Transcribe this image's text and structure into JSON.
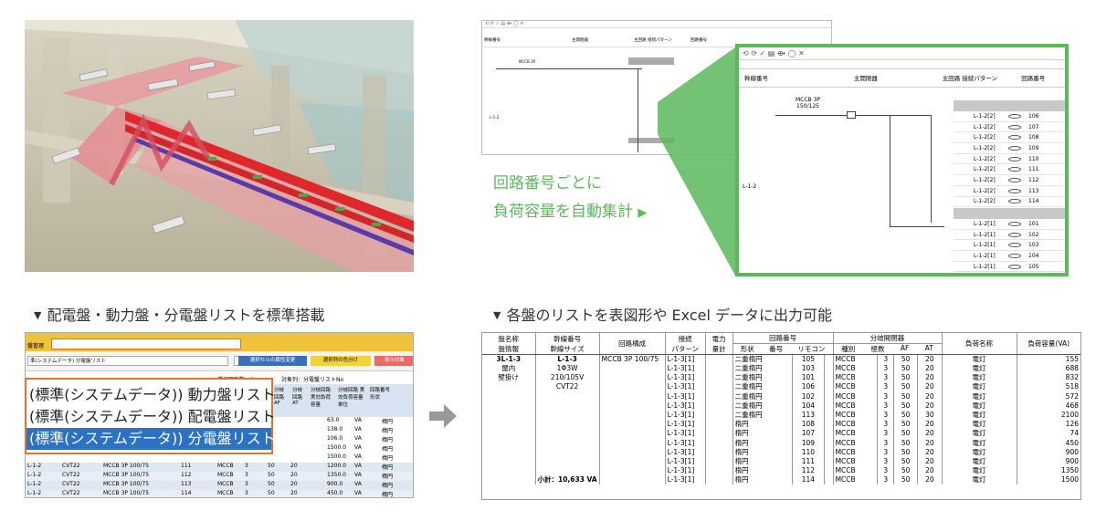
{
  "callout": {
    "line1": "回路番号ごとに",
    "line2": "負荷容量を自動集計",
    "arrow": "▶",
    "color": "#5cb85c"
  },
  "captions": {
    "left": "配電盤・動力盤・分電盤リストを標準搭載",
    "right": "各盤のリストを表図形や Excel データに出力可能",
    "marker": "▼"
  },
  "schematic": {
    "toolbar_icons": "⟲ ⟳ ✓ ▤ ⟴ ◯ ✕",
    "headers": [
      "幹線番号",
      "主開閉器",
      "主回路 接続パターン",
      "回路番号"
    ],
    "main_label": "L-1-2",
    "breaker": "MCCB 3P",
    "breaker_rating": "150/125",
    "rows_a": [
      {
        "circuit": "L-1-2[2]",
        "num": "106"
      },
      {
        "circuit": "L-1-2[2]",
        "num": "107"
      },
      {
        "circuit": "L-1-2[2]",
        "num": "108"
      },
      {
        "circuit": "L-1-2[2]",
        "num": "109"
      },
      {
        "circuit": "L-1-2[2]",
        "num": "110"
      },
      {
        "circuit": "L-1-2[2]",
        "num": "111"
      },
      {
        "circuit": "L-1-2[2]",
        "num": "112"
      },
      {
        "circuit": "L-1-2[2]",
        "num": "113"
      },
      {
        "circuit": "L-1-2[2]",
        "num": "114"
      }
    ],
    "rows_b": [
      {
        "circuit": "L-1-2[1]",
        "num": "101"
      },
      {
        "circuit": "L-1-2[1]",
        "num": "102"
      },
      {
        "circuit": "L-1-2[1]",
        "num": "103"
      },
      {
        "circuit": "L-1-2[1]",
        "num": "104"
      },
      {
        "circuit": "L-1-2[1]",
        "num": "105"
      }
    ]
  },
  "listwin": {
    "menu": "盤管理",
    "dropdown": "準(システムデータ) 分電盤リスト",
    "btn_attr": "選択セルの属性変更",
    "btn_color": "選択列の色分け",
    "btn_extra": "表示対象",
    "selected_rows": "選択図形数：1",
    "target_col": "対象列：分電盤リストNo",
    "col_headers": [
      "分岐回路 AF",
      "分岐回路 AT",
      "分岐回路 実効負荷容量",
      "分岐回路 実効負荷容量単位",
      "回路番号 形状"
    ],
    "rows": [
      {
        "a": "L-1-2",
        "b": "CVT22",
        "c": "MCCB 3P 100/75",
        "d": "111",
        "e": "MCCB",
        "f": "3",
        "g": "50",
        "h": "20",
        "i": "1200.0",
        "j": "VA",
        "k": "楕円"
      },
      {
        "a": "L-1-2",
        "b": "CVT22",
        "c": "MCCB 3P 100/75",
        "d": "112",
        "e": "MCCB",
        "f": "3",
        "g": "50",
        "h": "20",
        "i": "1350.0",
        "j": "VA",
        "k": "楕円"
      },
      {
        "a": "L-1-2",
        "b": "CVT22",
        "c": "MCCB 3P 100/75",
        "d": "113",
        "e": "MCCB",
        "f": "3",
        "g": "50",
        "h": "20",
        "i": "900.0",
        "j": "VA",
        "k": "楕円"
      },
      {
        "a": "L-1-2",
        "b": "CVT22",
        "c": "MCCB 3P 100/75",
        "d": "114",
        "e": "MCCB",
        "f": "3",
        "g": "50",
        "h": "20",
        "i": "450.0",
        "j": "VA",
        "k": "楕円"
      }
    ],
    "upper_vals": [
      {
        "i": "63.0",
        "j": "VA",
        "k": "楕円"
      },
      {
        "i": "138.0",
        "j": "VA",
        "k": "楕円"
      },
      {
        "i": "106.0",
        "j": "VA",
        "k": "楕円"
      },
      {
        "i": "1500.0",
        "j": "VA",
        "k": "楕円"
      },
      {
        "i": "1500.0",
        "j": "VA",
        "k": "楕円"
      }
    ],
    "overlay": [
      "(標準(システムデータ)) 動力盤リスト",
      "(標準(システムデータ)) 配電盤リスト",
      "(標準(システムデータ)) 分電盤リスト"
    ]
  },
  "excel": {
    "headers": {
      "panel": "盤名称",
      "panel_base": "盤情報",
      "trunk": "幹線番号",
      "trunk_size": "幹線サイズ",
      "circuit_cfg": "回路構成",
      "conn": "接続",
      "conn2": "パターン",
      "power": "電力",
      "power2": "量計",
      "circuit_num": "回路番号",
      "shape": "形状",
      "num": "番号",
      "remote": "リモコン",
      "branch": "分岐開閉器",
      "type": "種別",
      "poles": "極数",
      "af": "AF",
      "at": "AT",
      "load_name": "負荷名称",
      "load_cap": "負荷容量(VA)"
    },
    "panel": {
      "name": "3L-1-3",
      "loc": "屋内",
      "mount": "壁掛け"
    },
    "trunk": {
      "num": "L-1-3",
      "phase": "1Φ3W",
      "volt": "210/105V",
      "cable": "CVT22"
    },
    "circuit_cfg": "MCCB 3P 100/75",
    "subtotal": "小計：10,633 VA",
    "rows": [
      {
        "conn": "L-1-3[1]",
        "shape": "二重楕円",
        "num": "105",
        "type": "MCCB",
        "poles": "3",
        "af": "50",
        "at": "20",
        "load": "電灯",
        "cap": "155"
      },
      {
        "conn": "L-1-3[1]",
        "shape": "二重楕円",
        "num": "103",
        "type": "MCCB",
        "poles": "3",
        "af": "50",
        "at": "20",
        "load": "電灯",
        "cap": "688"
      },
      {
        "conn": "L-1-3[1]",
        "shape": "二重楕円",
        "num": "101",
        "type": "MCCB",
        "poles": "3",
        "af": "50",
        "at": "20",
        "load": "電灯",
        "cap": "832"
      },
      {
        "conn": "L-1-3[1]",
        "shape": "二重楕円",
        "num": "106",
        "type": "MCCB",
        "poles": "3",
        "af": "50",
        "at": "20",
        "load": "電灯",
        "cap": "518"
      },
      {
        "conn": "L-1-3[1]",
        "shape": "二重楕円",
        "num": "102",
        "type": "MCCB",
        "poles": "3",
        "af": "50",
        "at": "20",
        "load": "電灯",
        "cap": "572"
      },
      {
        "conn": "L-1-3[1]",
        "shape": "二重楕円",
        "num": "104",
        "type": "MCCB",
        "poles": "3",
        "af": "50",
        "at": "20",
        "load": "電灯",
        "cap": "468"
      },
      {
        "conn": "L-1-3[1]",
        "shape": "二重楕円",
        "num": "113",
        "type": "MCCB",
        "poles": "3",
        "af": "50",
        "at": "30",
        "load": "電灯",
        "cap": "2100"
      },
      {
        "conn": "L-1-3[1]",
        "shape": "楕円",
        "num": "108",
        "type": "MCCB",
        "poles": "3",
        "af": "50",
        "at": "20",
        "load": "電灯",
        "cap": "126"
      },
      {
        "conn": "L-1-3[1]",
        "shape": "楕円",
        "num": "107",
        "type": "MCCB",
        "poles": "3",
        "af": "50",
        "at": "20",
        "load": "電灯",
        "cap": "74"
      },
      {
        "conn": "L-1-3[1]",
        "shape": "楕円",
        "num": "109",
        "type": "MCCB",
        "poles": "3",
        "af": "50",
        "at": "20",
        "load": "電灯",
        "cap": "450"
      },
      {
        "conn": "L-1-3[1]",
        "shape": "楕円",
        "num": "110",
        "type": "MCCB",
        "poles": "3",
        "af": "50",
        "at": "20",
        "load": "電灯",
        "cap": "900"
      },
      {
        "conn": "L-1-3[1]",
        "shape": "楕円",
        "num": "111",
        "type": "MCCB",
        "poles": "3",
        "af": "50",
        "at": "20",
        "load": "電灯",
        "cap": "900"
      },
      {
        "conn": "L-1-3[1]",
        "shape": "楕円",
        "num": "112",
        "type": "MCCB",
        "poles": "3",
        "af": "50",
        "at": "20",
        "load": "電灯",
        "cap": "1350"
      },
      {
        "conn": "L-1-3[1]",
        "shape": "楕円",
        "num": "114",
        "type": "MCCB",
        "poles": "3",
        "af": "50",
        "at": "20",
        "load": "電灯",
        "cap": "1500"
      }
    ]
  }
}
